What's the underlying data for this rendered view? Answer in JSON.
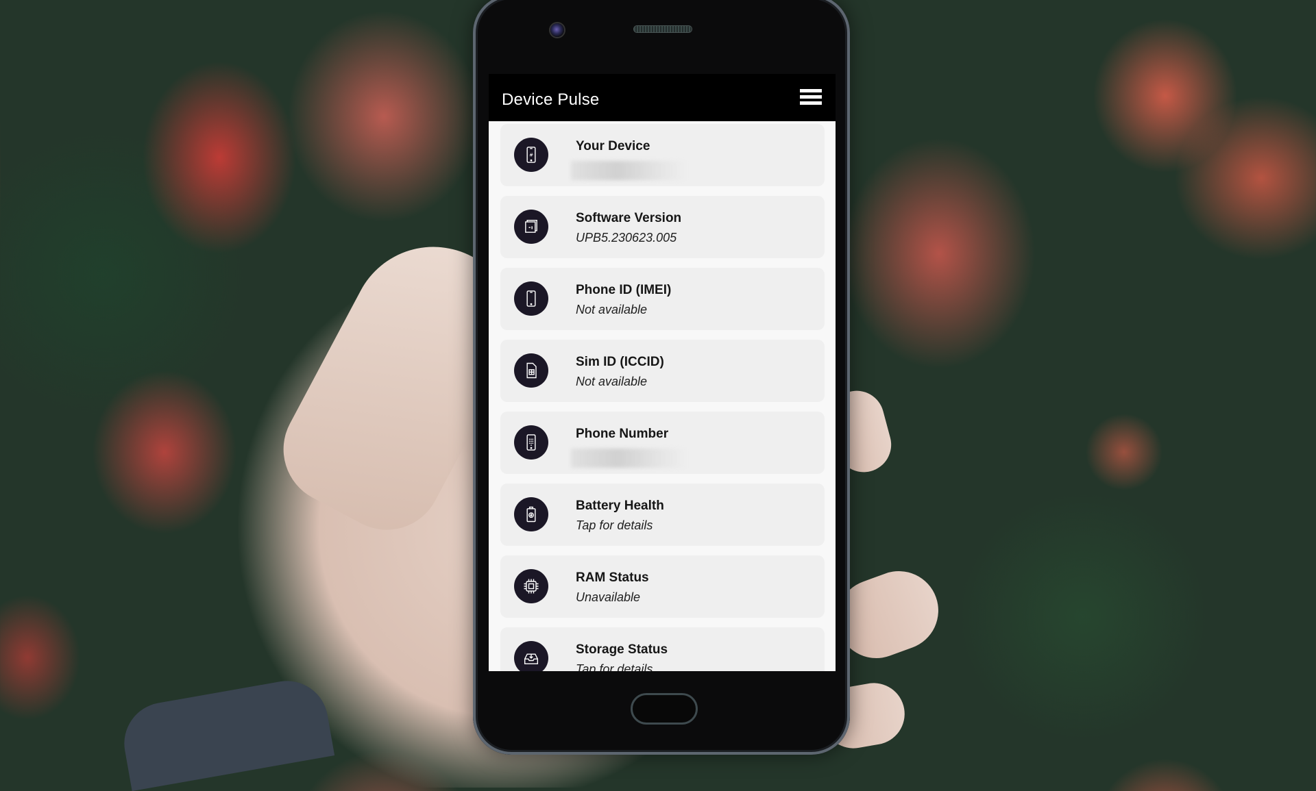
{
  "app": {
    "title": "Device Pulse",
    "menu_icon": "hamburger-menu-icon"
  },
  "items": [
    {
      "title": "Your Device",
      "value": null,
      "value_redacted": true,
      "icon": "phone-hash-icon"
    },
    {
      "title": "Software Version",
      "value": "UPB5.230623.005",
      "icon": "software-info-icon"
    },
    {
      "title": "Phone ID (IMEI)",
      "value": "Not available",
      "icon": "smartphone-icon"
    },
    {
      "title": "Sim ID (ICCID)",
      "value": "Not available",
      "icon": "sim-card-icon"
    },
    {
      "title": "Phone Number",
      "value": null,
      "value_redacted": true,
      "icon": "phone-keypad-icon"
    },
    {
      "title": "Battery Health",
      "value": "Tap for details",
      "icon": "battery-icon"
    },
    {
      "title": "RAM Status",
      "value": "Unavailable",
      "icon": "chip-icon"
    },
    {
      "title": "Storage Status",
      "value": "Tap for details",
      "icon": "storage-inbox-icon"
    }
  ],
  "colors": {
    "header_bg": "#000000",
    "card_bg": "#efefef",
    "icon_circle": "#1b1726",
    "screen_bg": "#f8f8f8"
  }
}
